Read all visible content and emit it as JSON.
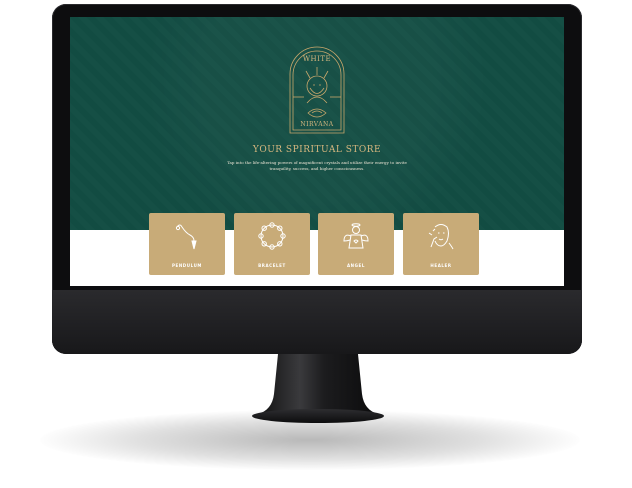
{
  "hero": {
    "logo_top_text": "WHITE",
    "logo_bottom_text": "NIRVANA",
    "title": "YOUR SPIRITUAL STORE",
    "description": "Tap into the life-altering powers of magnificent crystals and utilize their energy to invite tranquility, success, and higher consciousness."
  },
  "categories": [
    {
      "label": "PENDULUM",
      "icon": "pendulum-icon"
    },
    {
      "label": "BRACELET",
      "icon": "bracelet-icon"
    },
    {
      "label": "ANGEL",
      "icon": "angel-icon"
    },
    {
      "label": "HEALER",
      "icon": "healer-icon"
    }
  ],
  "colors": {
    "hero_bg": "#124d43",
    "gold": "#d6b77f",
    "card_bg": "#c8ab78",
    "bezel": "#0d0d0f"
  }
}
